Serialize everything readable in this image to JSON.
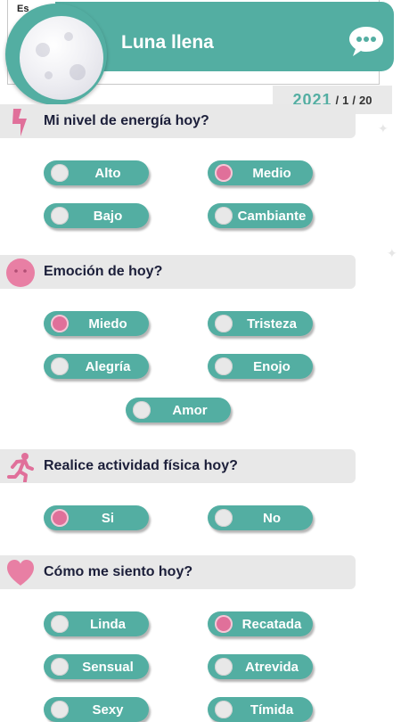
{
  "top_stub": "Es",
  "header": {
    "title": "Luna llena"
  },
  "date": {
    "year": "2021",
    "sep1": "/",
    "month": "1",
    "sep2": "/",
    "day": "20"
  },
  "sections": {
    "energy": {
      "question": "Mi nivel de energía hoy?",
      "options": [
        {
          "label": "Alto",
          "selected": false
        },
        {
          "label": "Medio",
          "selected": true
        },
        {
          "label": "Bajo",
          "selected": false
        },
        {
          "label": "Cambiante",
          "selected": false
        }
      ]
    },
    "emotion": {
      "question": "Emoción de hoy?",
      "options": [
        {
          "label": "Miedo",
          "selected": true
        },
        {
          "label": "Tristeza",
          "selected": false
        },
        {
          "label": "Alegría",
          "selected": false
        },
        {
          "label": "Enojo",
          "selected": false
        },
        {
          "label": "Amor",
          "selected": false
        }
      ]
    },
    "activity": {
      "question": "Realice actividad física hoy?",
      "options": [
        {
          "label": "Si",
          "selected": true
        },
        {
          "label": "No",
          "selected": false
        }
      ]
    },
    "feeling": {
      "question": "Cómo me siento hoy?",
      "options": [
        {
          "label": "Linda",
          "selected": false
        },
        {
          "label": "Recatada",
          "selected": true
        },
        {
          "label": "Sensual",
          "selected": false
        },
        {
          "label": "Atrevida",
          "selected": false
        },
        {
          "label": "Sexy",
          "selected": false
        },
        {
          "label": "Tímida",
          "selected": false
        }
      ]
    }
  },
  "colors": {
    "teal": "#53aea2",
    "pink": "#e0709a",
    "bar": "#e8e8e8",
    "text": "#1c1f3a"
  },
  "icons": {
    "energy": "lightning-icon",
    "emotion": "neutral-face-icon",
    "activity": "running-person-icon",
    "feeling": "heart-icon",
    "header": "chat-bubble-icon"
  }
}
